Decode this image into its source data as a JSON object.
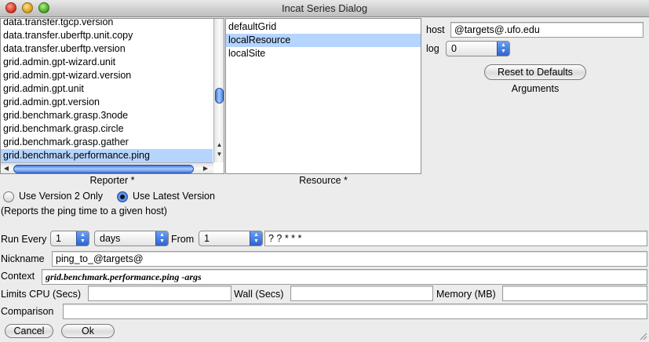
{
  "window": {
    "title": "Incat Series Dialog"
  },
  "reporter_list": {
    "caption": "Reporter *",
    "items": [
      "data.transfer.tgcp.version",
      "data.transfer.uberftp.unit.copy",
      "data.transfer.uberftp.version",
      "grid.admin.gpt-wizard.unit",
      "grid.admin.gpt-wizard.version",
      "grid.admin.gpt.unit",
      "grid.admin.gpt.version",
      "grid.benchmark.grasp.3node",
      "grid.benchmark.grasp.circle",
      "grid.benchmark.grasp.gather",
      "grid.benchmark.performance.ping"
    ],
    "selected": "grid.benchmark.performance.ping"
  },
  "resource_list": {
    "caption": "Resource *",
    "items": [
      "defaultGrid",
      "localResource",
      "localSite"
    ],
    "selected": "localResource"
  },
  "arguments": {
    "host_label": "host",
    "host_value": "@targets@.ufo.edu",
    "log_label": "log",
    "log_value": "0",
    "reset_button": "Reset to Defaults",
    "caption": "Arguments"
  },
  "version": {
    "option_v2": "Use Version 2 Only",
    "option_latest": "Use Latest Version",
    "selected": "Use Latest Version",
    "description": "(Reports the ping time to a given host)"
  },
  "schedule": {
    "run_every_label": "Run Every",
    "run_every_value": "1",
    "unit_value": "days",
    "from_label": "From",
    "from_value": "1",
    "cron_value": "? ? * * *"
  },
  "nickname": {
    "label": "Nickname",
    "value": "ping_to_@targets@"
  },
  "context": {
    "label": "Context",
    "value": "grid.benchmark.performance.ping -args"
  },
  "limits": {
    "cpu_label": "Limits CPU (Secs)",
    "cpu_value": "",
    "wall_label": "Wall (Secs)",
    "wall_value": "",
    "memory_label": "Memory (MB)",
    "memory_value": ""
  },
  "comparison": {
    "label": "Comparison",
    "value": ""
  },
  "buttons": {
    "cancel": "Cancel",
    "ok": "Ok"
  },
  "colors": {
    "selection": "#b5d5ff",
    "accent": "#2c64d0"
  }
}
